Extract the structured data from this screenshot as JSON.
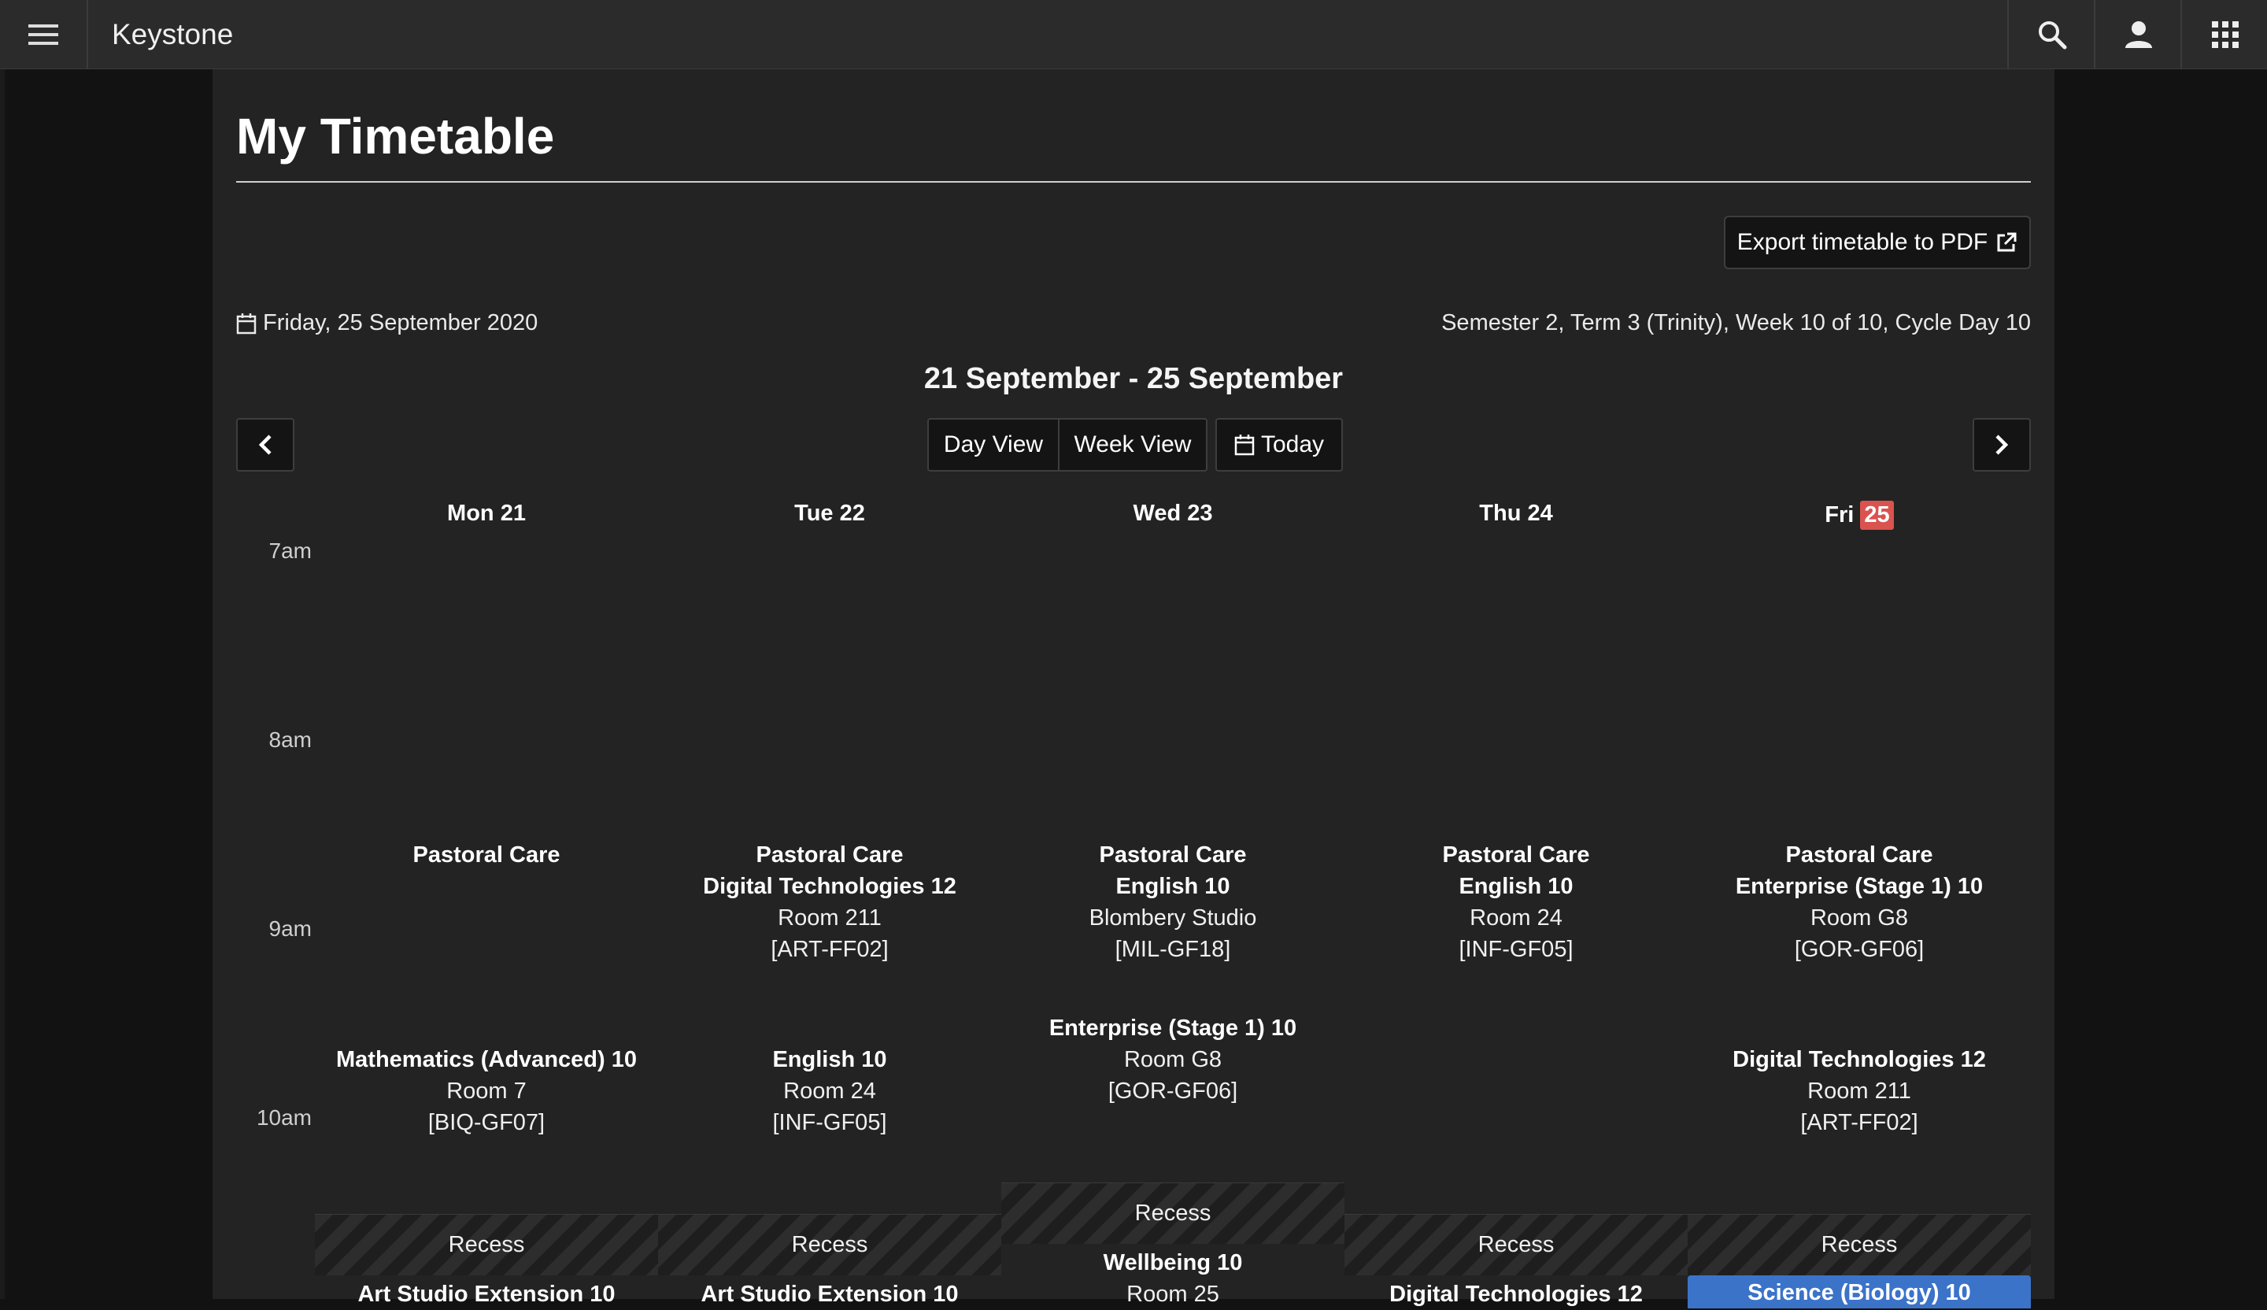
{
  "app": {
    "title": "Keystone"
  },
  "topbar": {
    "menu_icon": "hamburger-menu-icon",
    "search_icon": "search-icon",
    "user_icon": "user-icon",
    "apps_icon": "grid-apps-icon"
  },
  "page": {
    "title": "My Timetable",
    "export_label": "Export timetable to PDF",
    "current_date": "Friday, 25 September 2020",
    "term_info": "Semester 2, Term 3 (Trinity), Week 10 of 10, Cycle Day 10",
    "range_title": "21 September - 25 September",
    "view_buttons": {
      "day": "Day View",
      "week": "Week View",
      "today": "Today"
    }
  },
  "calendar": {
    "days": [
      {
        "label": "Mon 21"
      },
      {
        "label": "Tue 22"
      },
      {
        "label": "Wed 23"
      },
      {
        "label": "Thu 24"
      },
      {
        "label": "Fri",
        "badge": "25"
      }
    ],
    "times": [
      "7am",
      "8am",
      "9am",
      "10am"
    ],
    "pastoral": [
      {
        "title": "Pastoral Care",
        "subject": "",
        "room": "",
        "code": ""
      },
      {
        "title": "Pastoral Care",
        "subject": "Digital Technologies 12",
        "room": "Room 211",
        "code": "[ART-FF02]"
      },
      {
        "title": "Pastoral Care",
        "subject": "English 10",
        "room": "Blombery Studio",
        "code": "[MIL-GF18]"
      },
      {
        "title": "Pastoral Care",
        "subject": "English 10",
        "room": "Room 24",
        "code": "[INF-GF05]"
      },
      {
        "title": "Pastoral Care",
        "subject": "Enterprise (Stage 1) 10",
        "room": "Room G8",
        "code": "[GOR-GF06]"
      }
    ],
    "period1": [
      {
        "subject": "Mathematics (Advanced) 10",
        "room": "Room 7",
        "code": "[BIQ-GF07]"
      },
      {
        "subject": "English 10",
        "room": "Room 24",
        "code": "[INF-GF05]"
      },
      {
        "subject": "Enterprise (Stage 1) 10",
        "room": "Room G8",
        "code": "[GOR-GF06]"
      },
      null,
      {
        "subject": "Digital Technologies 12",
        "room": "Room 211",
        "code": "[ART-FF02]"
      }
    ],
    "recess_label": "Recess",
    "after_recess": [
      {
        "subject": "Art Studio Extension 10",
        "room": ""
      },
      {
        "subject": "Art Studio Extension 10",
        "room": ""
      },
      {
        "subject": "Wellbeing 10",
        "room": "Room 25"
      },
      {
        "subject": "Digital Technologies 12",
        "room": ""
      },
      {
        "subject": "Science (Biology) 10",
        "room": ""
      }
    ]
  },
  "colors": {
    "today_badge": "#d9534f",
    "selected_event": "#3b73c9"
  }
}
